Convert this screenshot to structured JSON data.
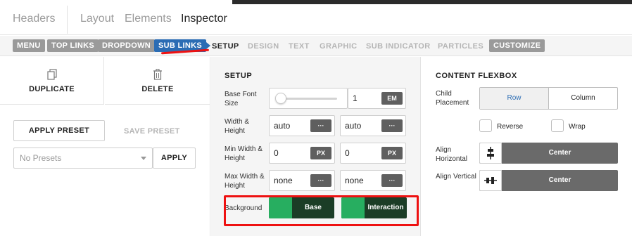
{
  "header": {
    "tabs": [
      {
        "label": "Headers"
      },
      {
        "label": "Layout"
      },
      {
        "label": "Elements"
      },
      {
        "label": "Inspector"
      }
    ]
  },
  "breadcrumbs": {
    "chips": [
      {
        "label": "MENU"
      },
      {
        "label": "TOP LINKS"
      },
      {
        "label": "DROPDOWN"
      },
      {
        "label": "SUB LINKS"
      }
    ],
    "items": [
      {
        "label": "SETUP"
      },
      {
        "label": "DESIGN"
      },
      {
        "label": "TEXT"
      },
      {
        "label": "GRAPHIC"
      },
      {
        "label": "SUB INDICATOR"
      },
      {
        "label": "PARTICLES"
      }
    ],
    "customize": "CUSTOMIZE"
  },
  "left": {
    "duplicate": "DUPLICATE",
    "delete": "DELETE",
    "apply_preset": "APPLY PRESET",
    "save_preset": "SAVE PRESET",
    "presets_select": "No Presets",
    "apply": "APPLY"
  },
  "setup": {
    "title": "SETUP",
    "base_font_size": {
      "label": "Base Font Size",
      "value": "1",
      "unit": "EM"
    },
    "width_height": {
      "label": "Width & Height",
      "width": "auto",
      "height": "auto",
      "unit": "···"
    },
    "min_width_height": {
      "label": "Min Width & Height",
      "width": "0",
      "height": "0",
      "unit": "PX"
    },
    "max_width_height": {
      "label": "Max Width & Height",
      "width": "none",
      "height": "none",
      "unit": "···"
    },
    "background": {
      "label": "Background",
      "base": "Base",
      "interaction": "Interaction"
    }
  },
  "flexbox": {
    "title": "CONTENT FLEXBOX",
    "child_placement": {
      "label": "Child Placement",
      "options": [
        "Row",
        "Column"
      ],
      "selected": "Row"
    },
    "reverse": "Reverse",
    "wrap": "Wrap",
    "align_horizontal": {
      "label": "Align Horizontal",
      "value": "Center"
    },
    "align_vertical": {
      "label": "Align Vertical",
      "value": "Center"
    }
  },
  "colors": {
    "accent_blue": "#2b6cb4",
    "toggle_green": "#27ae60",
    "toggle_dark": "#1b3d26",
    "highlight_red": "#ee1111"
  }
}
